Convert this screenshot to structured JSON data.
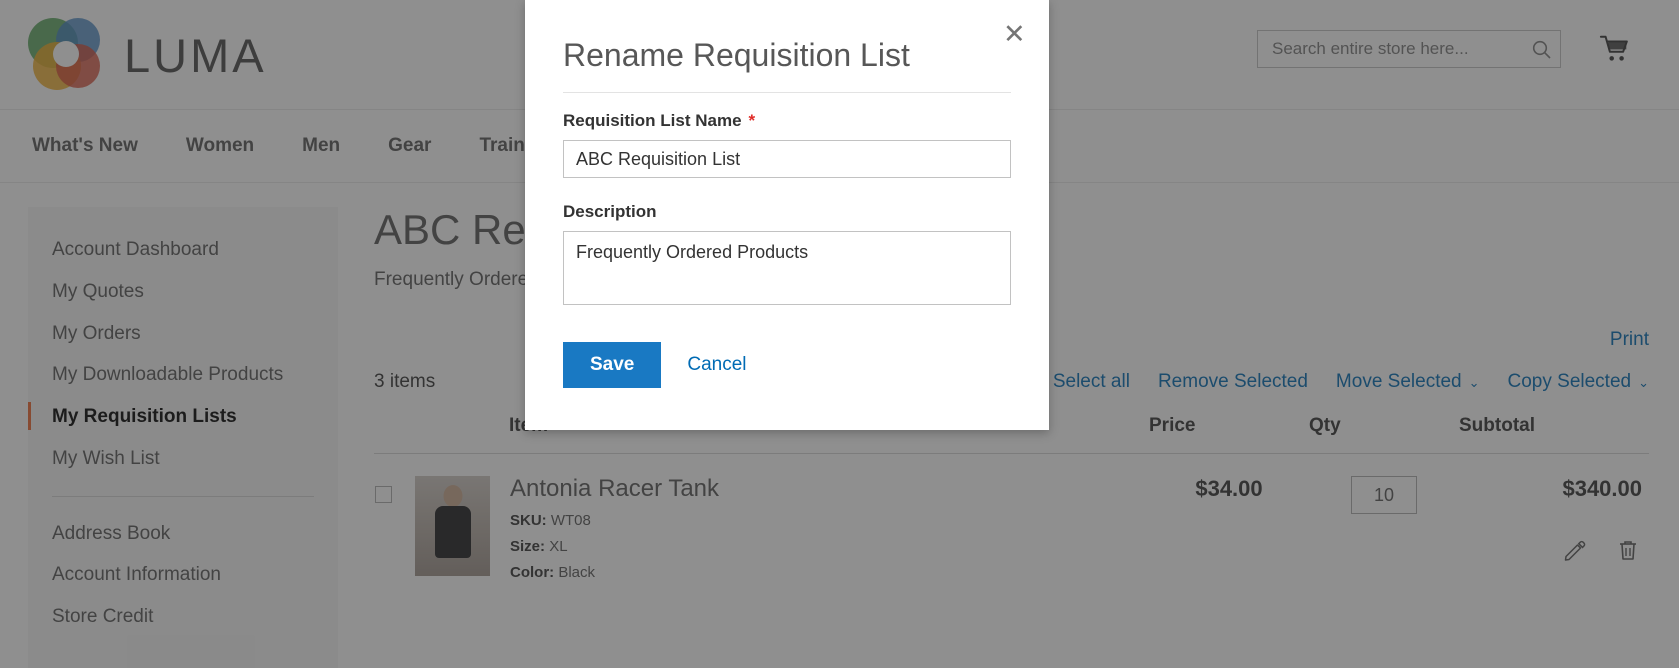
{
  "header": {
    "brand": "LUMA",
    "search": {
      "placeholder": "Search entire store here...",
      "value": ""
    },
    "search_icon": "search-icon",
    "cart_icon": "cart-icon"
  },
  "nav": {
    "items": [
      {
        "label": "What's New"
      },
      {
        "label": "Women"
      },
      {
        "label": "Men"
      },
      {
        "label": "Gear"
      },
      {
        "label": "Training"
      }
    ]
  },
  "sidebar": {
    "items": [
      {
        "label": "Account Dashboard",
        "active": false
      },
      {
        "label": "My Quotes",
        "active": false
      },
      {
        "label": "My Orders",
        "active": false
      },
      {
        "label": "My Downloadable Products",
        "active": false
      },
      {
        "label": "My Requisition Lists",
        "active": true
      },
      {
        "label": "My Wish List",
        "active": false
      }
    ],
    "items2": [
      {
        "label": "Address Book"
      },
      {
        "label": "Account Information"
      },
      {
        "label": "Store Credit"
      }
    ],
    "active_accent": "#ee672f"
  },
  "main": {
    "title": "ABC Requisition List",
    "subtitle": "Frequently Ordered Products",
    "print_label": "Print",
    "items_count": "3 items",
    "actions": [
      {
        "label": "Select all",
        "caret": ""
      },
      {
        "label": "Remove Selected",
        "caret": ""
      },
      {
        "label": "Move Selected",
        "caret": "⌄"
      },
      {
        "label": "Copy Selected",
        "caret": "⌄"
      }
    ],
    "table": {
      "columns": [
        "Item",
        "Price",
        "Qty",
        "Subtotal"
      ],
      "rows": [
        {
          "name": "Antonia Racer Tank",
          "sku_label": "SKU:",
          "sku": "WT08",
          "size_label": "Size:",
          "size": "XL",
          "color_label": "Color:",
          "color": "Black",
          "price": "$34.00",
          "qty": "10",
          "subtotal": "$340.00",
          "edit_icon": "pencil-icon",
          "delete_icon": "trash-icon"
        }
      ]
    }
  },
  "modal": {
    "title": "Rename Requisition List",
    "close_icon": "close-icon",
    "name_label": "Requisition List Name",
    "required_mark": "*",
    "name_value": "ABC Requisition List",
    "description_label": "Description",
    "description_value": "Frequently Ordered Products",
    "save_label": "Save",
    "cancel_label": "Cancel",
    "save_color": "#1979c3",
    "link_color": "#006bb4"
  }
}
